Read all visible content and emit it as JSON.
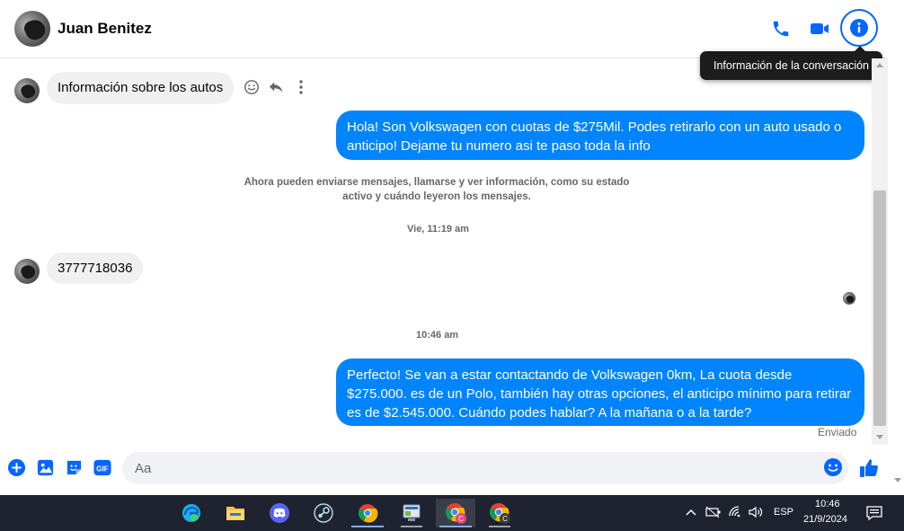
{
  "header": {
    "contact_name": "Juan Benitez",
    "tooltip": "Información de la conversación",
    "icons": [
      "phone-icon",
      "video-icon",
      "info-icon"
    ]
  },
  "messages": {
    "incoming_1": "Información sobre los autos",
    "outgoing_1": "Hola! Son Volkswagen con cuotas de $275Mil. Podes retirarlo con un auto usado o anticipo! Dejame tu numero asi te paso toda la info",
    "system_notice": "Ahora pueden enviarse mensajes, llamarse y ver información, como su estado activo y cuándo leyeron los mensajes.",
    "timestamp_1": "Vie, 11:19 am",
    "incoming_2": "3777718036",
    "timestamp_2": "10:46 am",
    "outgoing_2": "Perfecto!  Se van a estar contactando de Volkswagen 0km, La cuota desde $275.000. es de un Polo, también hay otras opciones, el anticipo mínimo para retirar es de $2.545.000. Cuándo podes hablar? A la mañana o a la tarde?",
    "sent_status": "Enviado"
  },
  "composer": {
    "placeholder": "Aa",
    "icons": [
      "plus-icon",
      "image-icon",
      "sticker-icon",
      "gif-icon",
      "emoji-icon",
      "like-icon"
    ],
    "gif_label": "GIF"
  },
  "taskbar": {
    "apps": [
      "edge-icon",
      "file-explorer-icon",
      "discord-icon",
      "steam-icon",
      "chrome-icon",
      "control-panel-icon",
      "chrome-profile-c-icon",
      "chrome-profile-c2-icon"
    ],
    "language": "ESP",
    "time": "10:46",
    "date": "21/9/2024"
  },
  "colors": {
    "accent": "#0866ff",
    "outgoing_bubble": "#0084ff",
    "incoming_bubble": "#f0f0f0",
    "taskbar": "#1f2330"
  }
}
